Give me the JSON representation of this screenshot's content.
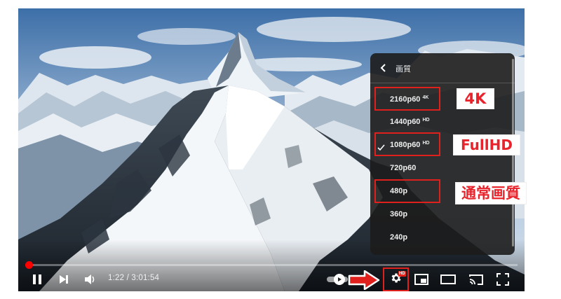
{
  "video": {
    "scene": "Snow-covered Matterhorn peak and mountain ridge under a cloudy blue sky",
    "time_current": "1:22",
    "time_separator": " / ",
    "time_total": "3:01:54",
    "progress_fraction": 0.0075
  },
  "controls": {
    "play_state": "pause",
    "settings_badge": "HD",
    "icons": [
      "pause-icon",
      "next-icon",
      "volume-icon",
      "autoplay-toggle",
      "settings-gear-icon",
      "miniplayer-icon",
      "theater-mode-icon",
      "cast-icon",
      "fullscreen-icon"
    ]
  },
  "quality_menu": {
    "title": "画質",
    "options": [
      {
        "label": "2160p60",
        "badge": "4K",
        "selected": false,
        "highlighted": true
      },
      {
        "label": "1440p60",
        "badge": "HD",
        "selected": false,
        "highlighted": false
      },
      {
        "label": "1080p60",
        "badge": "HD",
        "selected": true,
        "highlighted": true
      },
      {
        "label": "720p60",
        "badge": "",
        "selected": false,
        "highlighted": false
      },
      {
        "label": "480p",
        "badge": "",
        "selected": false,
        "highlighted": true
      },
      {
        "label": "360p",
        "badge": "",
        "selected": false,
        "highlighted": false
      },
      {
        "label": "240p",
        "badge": "",
        "selected": false,
        "highlighted": false
      }
    ]
  },
  "annotations": {
    "label_4k": "4K",
    "label_fullhd": "FullHD",
    "label_standard": "通常画質"
  },
  "colors": {
    "highlight_red": "#e0201c",
    "annotation_text": "#e8232b",
    "progress_red": "#ff0000",
    "menu_bg": "#1c1c1c"
  }
}
